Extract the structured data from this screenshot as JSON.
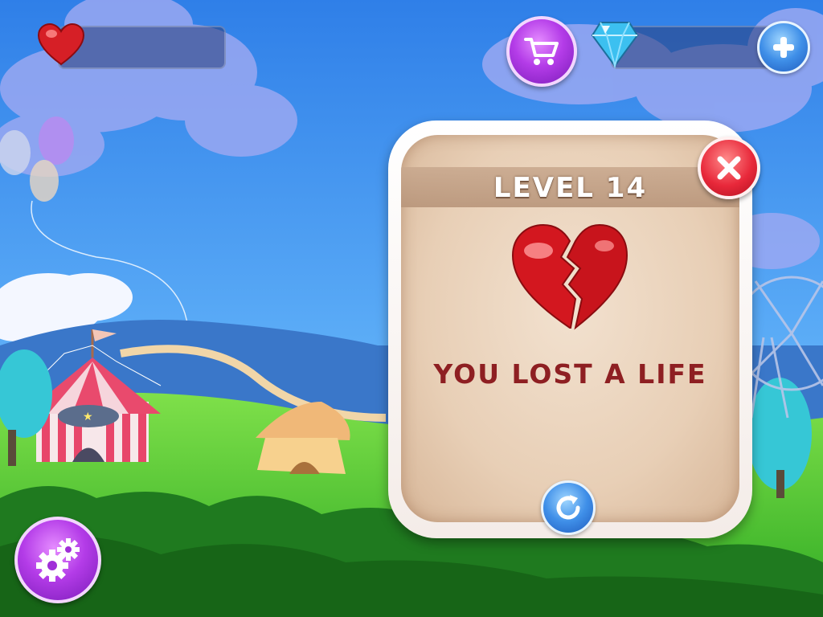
{
  "hud": {
    "lives_value": "",
    "gems_value": ""
  },
  "dialog": {
    "title": "LEVEL 14",
    "message": "YOU LOST A LIFE"
  },
  "icons": {
    "lives": "heart-icon",
    "shop": "cart-icon",
    "gems": "diamond-icon",
    "add_gems": "plus-icon",
    "close": "close-icon",
    "broken_heart": "broken-heart-icon",
    "retry": "retry-icon",
    "settings": "gear-icon"
  },
  "colors": {
    "sky": "#4a8ff0",
    "grass": "#3fbf2a",
    "message_red": "#8e1f22",
    "title_white": "#ffffff",
    "purple_button": "#b43ce8"
  }
}
